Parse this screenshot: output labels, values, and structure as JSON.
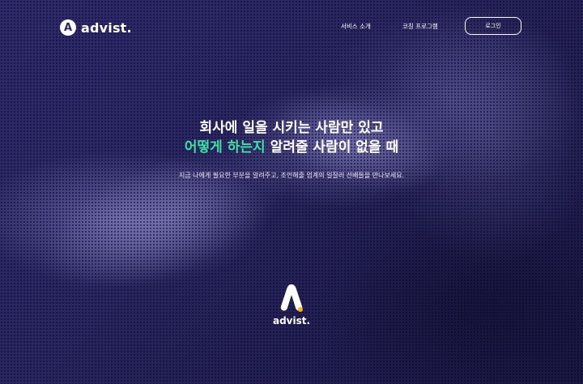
{
  "header": {
    "logo_text": "advist.",
    "logo_letter": "A",
    "nav": [
      {
        "label": "서비스 소개"
      },
      {
        "label": "코칭 프로그램"
      }
    ],
    "login_label": "로그인"
  },
  "hero": {
    "line1": "회사에 일을 시키는 사람만 있고",
    "line2_accent": "어떻게 하는지",
    "line2_rest": " 알려줄 사람이 없을 때",
    "subtext": "지금 나에게 필요한 부분을 알려주고, 조언해줄 업계의 일잘러 선배들을 만나보세요."
  },
  "footer_logo": {
    "text": "advist."
  },
  "colors": {
    "accent": "#3ee0a6",
    "brand_dot": "#f2b416",
    "background": "#2a2662"
  }
}
